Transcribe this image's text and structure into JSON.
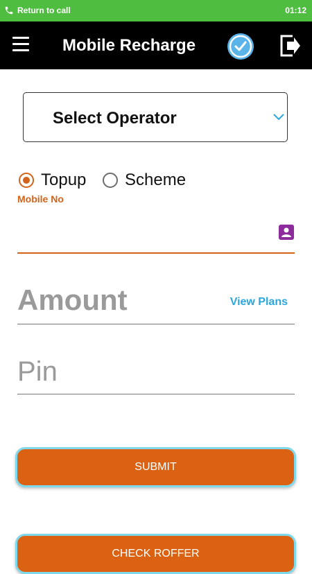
{
  "status_bar": {
    "call_text": "Return to call",
    "time": "01:12",
    "icon": "phone-icon"
  },
  "header": {
    "title": "Mobile Recharge",
    "icons": [
      "menu-icon",
      "verified-check-icon",
      "exit-icon"
    ]
  },
  "operator": {
    "label": "Select Operator",
    "icon": "chevron-down-icon"
  },
  "recharge_type": {
    "options": [
      "Topup",
      "Scheme"
    ],
    "selected": "Topup"
  },
  "mobile": {
    "label": "Mobile No",
    "value": "",
    "icon": "contact-icon"
  },
  "amount": {
    "placeholder": "Amount",
    "value": "",
    "link": "View Plans"
  },
  "pin": {
    "placeholder": "Pin",
    "value": ""
  },
  "buttons": {
    "submit": "SUBMIT",
    "check_offer": "CHECK ROFFER"
  },
  "colors": {
    "accent": "#d4631a",
    "link": "#2ba7dd",
    "status_bar": "#4fbd3f",
    "app_bar": "#000000",
    "button_border": "#7fd9ec"
  }
}
